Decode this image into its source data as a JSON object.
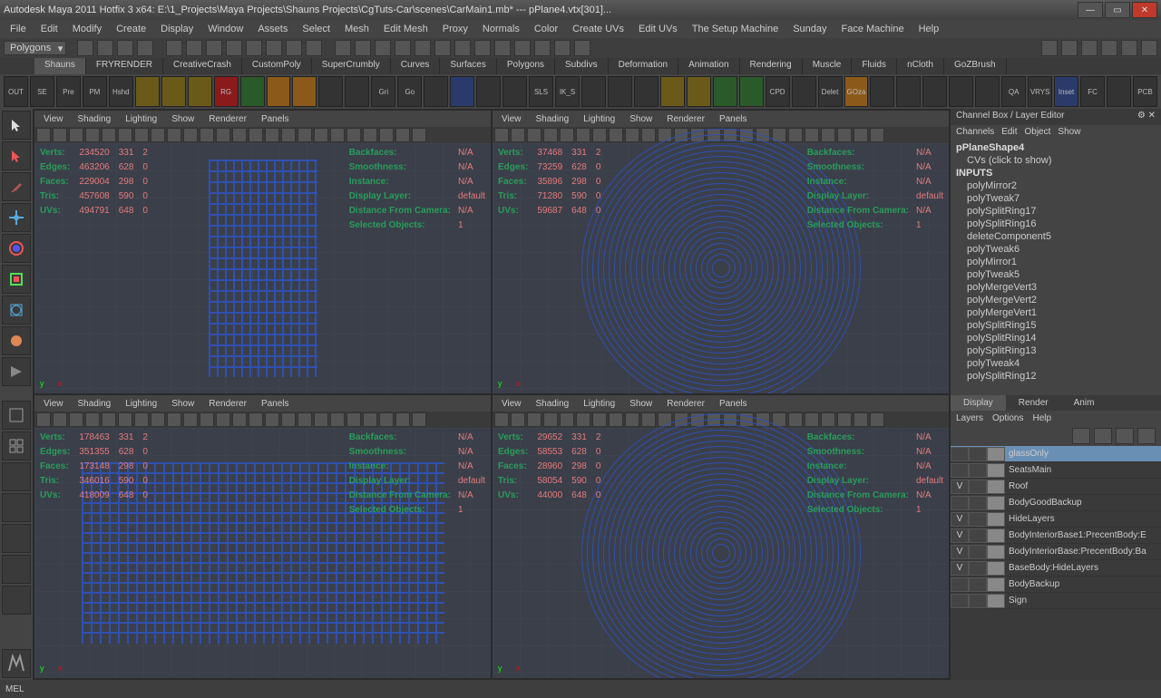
{
  "title": "Autodesk Maya 2011 Hotfix 3 x64: E:\\1_Projects\\Maya Projects\\Shauns Projects\\CgTuts-Car\\scenes\\CarMain1.mb*   ---   pPlane4.vtx[301]...",
  "menus": [
    "File",
    "Edit",
    "Modify",
    "Create",
    "Display",
    "Window",
    "Assets",
    "Select",
    "Mesh",
    "Edit Mesh",
    "Proxy",
    "Normals",
    "Color",
    "Create UVs",
    "Edit UVs",
    "The Setup Machine",
    "Sunday",
    "Face Machine",
    "Help"
  ],
  "mode_dropdown": "Polygons",
  "shelf_tabs": [
    "Shauns",
    "FRYRENDER",
    "CreativeCrash",
    "CustomPoly",
    "SuperCrumbly",
    "Curves",
    "Surfaces",
    "Polygons",
    "Subdivs",
    "Deformation",
    "Animation",
    "Rendering",
    "Muscle",
    "Fluids",
    "nCloth",
    "GoZBrush"
  ],
  "shelf_icons": [
    "OUT",
    "SE",
    "Pre",
    "PM",
    "Hshd",
    "",
    "",
    "",
    "RG",
    "",
    "",
    "",
    "",
    "",
    "Gri",
    "Go",
    "",
    "",
    "",
    "",
    "SLS",
    "IK_S",
    "",
    "",
    "",
    "",
    "",
    "",
    "",
    "CPD",
    "",
    "Delet",
    "GOza",
    "",
    "",
    "",
    "",
    "",
    "QA",
    "VRYS",
    "Inset",
    "FC",
    "",
    "PCB"
  ],
  "vp_menus": [
    "View",
    "Shading",
    "Lighting",
    "Show",
    "Renderer",
    "Panels"
  ],
  "stats_labels": [
    "Verts:",
    "Edges:",
    "Faces:",
    "Tris:",
    "UVs:"
  ],
  "stats2_labels": [
    "Backfaces:",
    "Smoothness:",
    "Instance:",
    "Display Layer:",
    "Distance From Camera:",
    "Selected Objects:"
  ],
  "viewports": [
    {
      "name": "top",
      "s": [
        [
          "234520",
          "331",
          "2"
        ],
        [
          "463206",
          "628",
          "0"
        ],
        [
          "229004",
          "298",
          "0"
        ],
        [
          "457608",
          "590",
          "0"
        ],
        [
          "494791",
          "648",
          "0"
        ]
      ],
      "s2": [
        "N/A",
        "N/A",
        "N/A",
        "default",
        "N/A",
        "1"
      ]
    },
    {
      "name": "persp",
      "s": [
        [
          "37468",
          "331",
          "2"
        ],
        [
          "73259",
          "628",
          "0"
        ],
        [
          "35896",
          "298",
          "0"
        ],
        [
          "71280",
          "590",
          "0"
        ],
        [
          "59687",
          "648",
          "0"
        ]
      ],
      "s2": [
        "N/A",
        "N/A",
        "N/A",
        "default",
        "N/A",
        "1"
      ]
    },
    {
      "name": "front",
      "s": [
        [
          "178463",
          "331",
          "2"
        ],
        [
          "351355",
          "628",
          "0"
        ],
        [
          "173148",
          "298",
          "0"
        ],
        [
          "346016",
          "590",
          "0"
        ],
        [
          "418009",
          "648",
          "0"
        ]
      ],
      "s2": [
        "N/A",
        "N/A",
        "N/A",
        "default",
        "N/A",
        "1"
      ]
    },
    {
      "name": "side",
      "s": [
        [
          "29652",
          "331",
          "2"
        ],
        [
          "58553",
          "628",
          "0"
        ],
        [
          "28960",
          "298",
          "0"
        ],
        [
          "58054",
          "590",
          "0"
        ],
        [
          "44000",
          "648",
          "0"
        ]
      ],
      "s2": [
        "N/A",
        "N/A",
        "N/A",
        "default",
        "N/A",
        "1"
      ]
    }
  ],
  "channel_title": "Channel Box / Layer Editor",
  "channel_menus": [
    "Channels",
    "Edit",
    "Object",
    "Show"
  ],
  "channel_header": "pPlaneShape4",
  "channel_cvs": "CVs (click to show)",
  "channel_inputs": "INPUTS",
  "channel_items": [
    "polyMirror2",
    "polyTweak7",
    "polySplitRing17",
    "polySplitRing16",
    "deleteComponent5",
    "polyTweak6",
    "polyMirror1",
    "polyTweak5",
    "polyMergeVert3",
    "polyMergeVert2",
    "polyMergeVert1",
    "polySplitRing15",
    "polySplitRing14",
    "polySplitRing13",
    "polyTweak4",
    "polySplitRing12"
  ],
  "layer_tabs": [
    "Display",
    "Render",
    "Anim"
  ],
  "layer_menu": [
    "Layers",
    "Options",
    "Help"
  ],
  "layers": [
    {
      "v": "",
      "name": "glassOnly",
      "sel": true
    },
    {
      "v": "",
      "name": "SeatsMain"
    },
    {
      "v": "V",
      "name": "Roof"
    },
    {
      "v": "",
      "name": "BodyGoodBackup"
    },
    {
      "v": "V",
      "name": "HideLayers"
    },
    {
      "v": "V",
      "name": "BodyInteriorBase1:PrecentBody:E"
    },
    {
      "v": "V",
      "name": "BodyInteriorBase:PrecentBody:Ba"
    },
    {
      "v": "V",
      "name": "BaseBody:HideLayers"
    },
    {
      "v": "",
      "name": "BodyBackup"
    },
    {
      "v": "",
      "name": "Sign"
    }
  ],
  "status": "MEL"
}
